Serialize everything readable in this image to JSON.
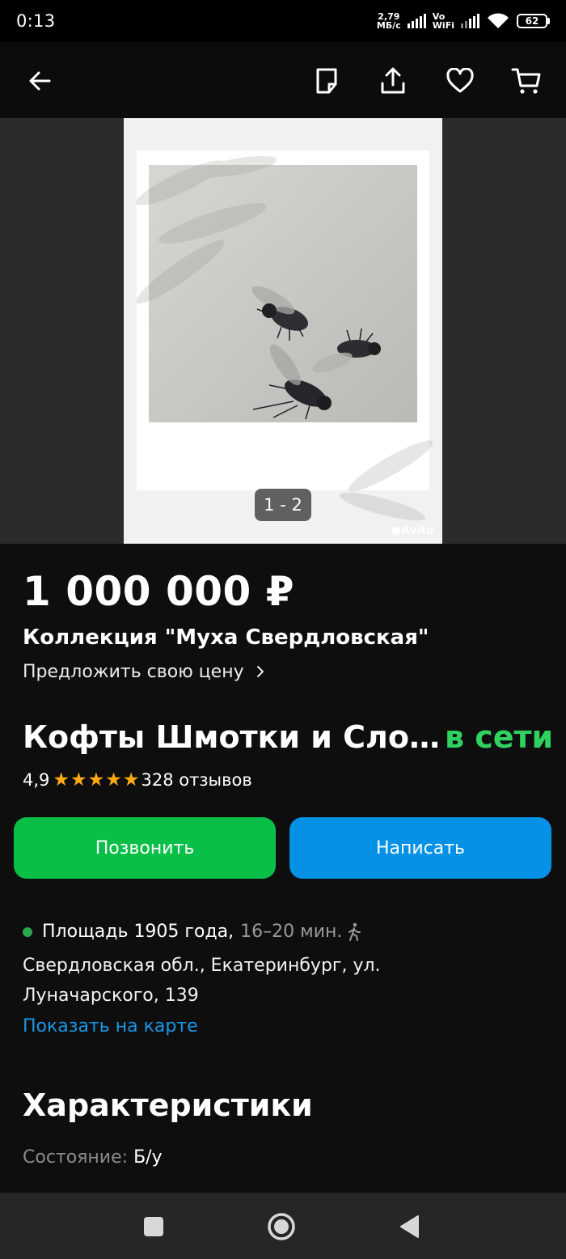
{
  "status": {
    "time": "0:13",
    "speed_value": "2,79",
    "speed_unit": "МБ/с",
    "net_top": "Vo",
    "net_bottom": "WiFi",
    "battery": "62"
  },
  "toolbar": {
    "icons": [
      "back-arrow-icon",
      "note-icon",
      "share-icon",
      "heart-icon",
      "cart-icon"
    ]
  },
  "gallery": {
    "counter": "1 - 2",
    "watermark": "Avito"
  },
  "listing": {
    "price": "1 000 000 ₽",
    "title": "Коллекция \"Муха Свердловская\"",
    "offer_price": "Предложить свою цену"
  },
  "seller": {
    "name": "Кофты Шмотки и Сло…",
    "online": "в сети",
    "rating": "4,9",
    "stars": 5,
    "reviews": "328 отзывов"
  },
  "actions": {
    "call": "Позвонить",
    "write": "Написать"
  },
  "location": {
    "metro": "Площадь 1905 года,",
    "metro_time": "16–20 мин.",
    "address": "Свердловская обл., Екатеринбург, ул. Луначарского, 139",
    "map_link": "Показать на карте"
  },
  "characteristics": {
    "title": "Характеристики",
    "items": [
      {
        "label": "Состояние:",
        "value": "Б/у"
      }
    ]
  },
  "colors": {
    "call_button": "#0abf48",
    "write_button": "#0591e6",
    "online": "#2fd25e",
    "link": "#1a97e8",
    "star": "#ffa914"
  }
}
